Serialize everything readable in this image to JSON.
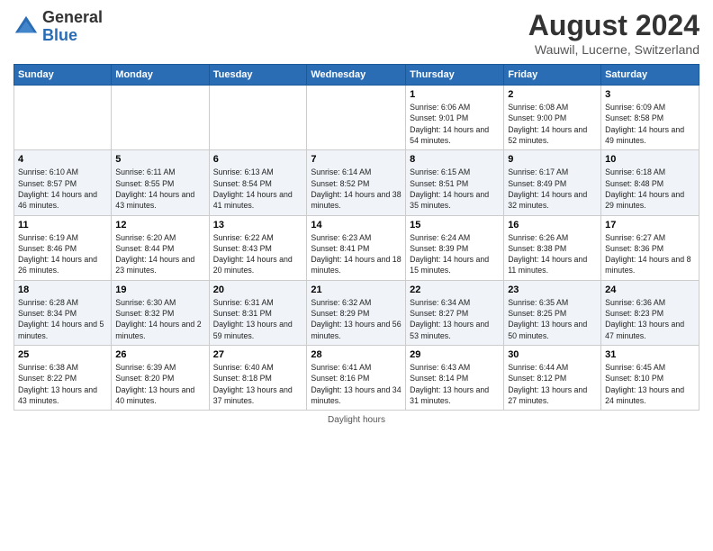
{
  "logo": {
    "general": "General",
    "blue": "Blue"
  },
  "title": "August 2024",
  "subtitle": "Wauwil, Lucerne, Switzerland",
  "days_of_week": [
    "Sunday",
    "Monday",
    "Tuesday",
    "Wednesday",
    "Thursday",
    "Friday",
    "Saturday"
  ],
  "footer": "Daylight hours",
  "weeks": [
    [
      {
        "num": "",
        "sunrise": "",
        "sunset": "",
        "daylight": ""
      },
      {
        "num": "",
        "sunrise": "",
        "sunset": "",
        "daylight": ""
      },
      {
        "num": "",
        "sunrise": "",
        "sunset": "",
        "daylight": ""
      },
      {
        "num": "",
        "sunrise": "",
        "sunset": "",
        "daylight": ""
      },
      {
        "num": "1",
        "sunrise": "Sunrise: 6:06 AM",
        "sunset": "Sunset: 9:01 PM",
        "daylight": "Daylight: 14 hours and 54 minutes."
      },
      {
        "num": "2",
        "sunrise": "Sunrise: 6:08 AM",
        "sunset": "Sunset: 9:00 PM",
        "daylight": "Daylight: 14 hours and 52 minutes."
      },
      {
        "num": "3",
        "sunrise": "Sunrise: 6:09 AM",
        "sunset": "Sunset: 8:58 PM",
        "daylight": "Daylight: 14 hours and 49 minutes."
      }
    ],
    [
      {
        "num": "4",
        "sunrise": "Sunrise: 6:10 AM",
        "sunset": "Sunset: 8:57 PM",
        "daylight": "Daylight: 14 hours and 46 minutes."
      },
      {
        "num": "5",
        "sunrise": "Sunrise: 6:11 AM",
        "sunset": "Sunset: 8:55 PM",
        "daylight": "Daylight: 14 hours and 43 minutes."
      },
      {
        "num": "6",
        "sunrise": "Sunrise: 6:13 AM",
        "sunset": "Sunset: 8:54 PM",
        "daylight": "Daylight: 14 hours and 41 minutes."
      },
      {
        "num": "7",
        "sunrise": "Sunrise: 6:14 AM",
        "sunset": "Sunset: 8:52 PM",
        "daylight": "Daylight: 14 hours and 38 minutes."
      },
      {
        "num": "8",
        "sunrise": "Sunrise: 6:15 AM",
        "sunset": "Sunset: 8:51 PM",
        "daylight": "Daylight: 14 hours and 35 minutes."
      },
      {
        "num": "9",
        "sunrise": "Sunrise: 6:17 AM",
        "sunset": "Sunset: 8:49 PM",
        "daylight": "Daylight: 14 hours and 32 minutes."
      },
      {
        "num": "10",
        "sunrise": "Sunrise: 6:18 AM",
        "sunset": "Sunset: 8:48 PM",
        "daylight": "Daylight: 14 hours and 29 minutes."
      }
    ],
    [
      {
        "num": "11",
        "sunrise": "Sunrise: 6:19 AM",
        "sunset": "Sunset: 8:46 PM",
        "daylight": "Daylight: 14 hours and 26 minutes."
      },
      {
        "num": "12",
        "sunrise": "Sunrise: 6:20 AM",
        "sunset": "Sunset: 8:44 PM",
        "daylight": "Daylight: 14 hours and 23 minutes."
      },
      {
        "num": "13",
        "sunrise": "Sunrise: 6:22 AM",
        "sunset": "Sunset: 8:43 PM",
        "daylight": "Daylight: 14 hours and 20 minutes."
      },
      {
        "num": "14",
        "sunrise": "Sunrise: 6:23 AM",
        "sunset": "Sunset: 8:41 PM",
        "daylight": "Daylight: 14 hours and 18 minutes."
      },
      {
        "num": "15",
        "sunrise": "Sunrise: 6:24 AM",
        "sunset": "Sunset: 8:39 PM",
        "daylight": "Daylight: 14 hours and 15 minutes."
      },
      {
        "num": "16",
        "sunrise": "Sunrise: 6:26 AM",
        "sunset": "Sunset: 8:38 PM",
        "daylight": "Daylight: 14 hours and 11 minutes."
      },
      {
        "num": "17",
        "sunrise": "Sunrise: 6:27 AM",
        "sunset": "Sunset: 8:36 PM",
        "daylight": "Daylight: 14 hours and 8 minutes."
      }
    ],
    [
      {
        "num": "18",
        "sunrise": "Sunrise: 6:28 AM",
        "sunset": "Sunset: 8:34 PM",
        "daylight": "Daylight: 14 hours and 5 minutes."
      },
      {
        "num": "19",
        "sunrise": "Sunrise: 6:30 AM",
        "sunset": "Sunset: 8:32 PM",
        "daylight": "Daylight: 14 hours and 2 minutes."
      },
      {
        "num": "20",
        "sunrise": "Sunrise: 6:31 AM",
        "sunset": "Sunset: 8:31 PM",
        "daylight": "Daylight: 13 hours and 59 minutes."
      },
      {
        "num": "21",
        "sunrise": "Sunrise: 6:32 AM",
        "sunset": "Sunset: 8:29 PM",
        "daylight": "Daylight: 13 hours and 56 minutes."
      },
      {
        "num": "22",
        "sunrise": "Sunrise: 6:34 AM",
        "sunset": "Sunset: 8:27 PM",
        "daylight": "Daylight: 13 hours and 53 minutes."
      },
      {
        "num": "23",
        "sunrise": "Sunrise: 6:35 AM",
        "sunset": "Sunset: 8:25 PM",
        "daylight": "Daylight: 13 hours and 50 minutes."
      },
      {
        "num": "24",
        "sunrise": "Sunrise: 6:36 AM",
        "sunset": "Sunset: 8:23 PM",
        "daylight": "Daylight: 13 hours and 47 minutes."
      }
    ],
    [
      {
        "num": "25",
        "sunrise": "Sunrise: 6:38 AM",
        "sunset": "Sunset: 8:22 PM",
        "daylight": "Daylight: 13 hours and 43 minutes."
      },
      {
        "num": "26",
        "sunrise": "Sunrise: 6:39 AM",
        "sunset": "Sunset: 8:20 PM",
        "daylight": "Daylight: 13 hours and 40 minutes."
      },
      {
        "num": "27",
        "sunrise": "Sunrise: 6:40 AM",
        "sunset": "Sunset: 8:18 PM",
        "daylight": "Daylight: 13 hours and 37 minutes."
      },
      {
        "num": "28",
        "sunrise": "Sunrise: 6:41 AM",
        "sunset": "Sunset: 8:16 PM",
        "daylight": "Daylight: 13 hours and 34 minutes."
      },
      {
        "num": "29",
        "sunrise": "Sunrise: 6:43 AM",
        "sunset": "Sunset: 8:14 PM",
        "daylight": "Daylight: 13 hours and 31 minutes."
      },
      {
        "num": "30",
        "sunrise": "Sunrise: 6:44 AM",
        "sunset": "Sunset: 8:12 PM",
        "daylight": "Daylight: 13 hours and 27 minutes."
      },
      {
        "num": "31",
        "sunrise": "Sunrise: 6:45 AM",
        "sunset": "Sunset: 8:10 PM",
        "daylight": "Daylight: 13 hours and 24 minutes."
      }
    ]
  ]
}
